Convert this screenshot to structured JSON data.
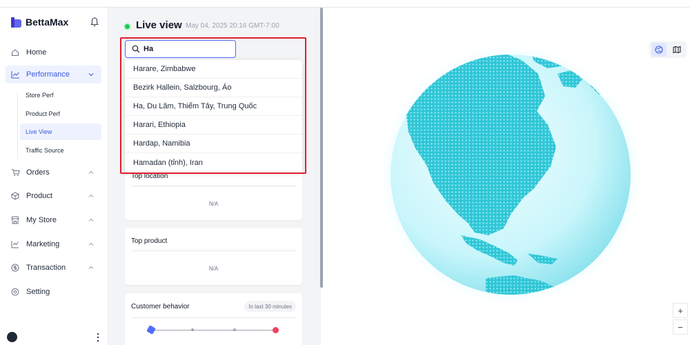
{
  "app": {
    "brand": "BettaMax"
  },
  "sidebar": {
    "items": [
      {
        "label": "Home",
        "icon": "home-icon"
      },
      {
        "label": "Performance",
        "icon": "chart-icon"
      },
      {
        "label": "Orders",
        "icon": "cart-icon"
      },
      {
        "label": "Product",
        "icon": "box-icon"
      },
      {
        "label": "My Store",
        "icon": "store-icon"
      },
      {
        "label": "Marketing",
        "icon": "megaphone-icon"
      },
      {
        "label": "Transaction",
        "icon": "money-icon"
      },
      {
        "label": "Setting",
        "icon": "gear-icon"
      }
    ],
    "performance_sub": [
      "Store Perf",
      "Product Perf",
      "Live View",
      "Traffic Source"
    ]
  },
  "live": {
    "title": "Live view",
    "datetime": "May 04, 2025 20:16 GMT-7:00"
  },
  "search": {
    "value": "Ha",
    "results": [
      "Harare, Zimbabwe",
      "Bezirk Hallein, Salzbourg, Áo",
      "Ha, Du Lâm, Thiểm Tây, Trung Quốc",
      "Harari, Ethiopia",
      "Hardap, Namibia",
      "Hamadan (tỉnh), Iran"
    ]
  },
  "cards": {
    "top_location": {
      "title": "Top location",
      "value": "N/A"
    },
    "top_product": {
      "title": "Top product",
      "value": "N/A"
    },
    "customer_behavior": {
      "title": "Customer behavior",
      "badge": "In last 30 minutes"
    }
  },
  "map": {
    "zoom_in": "+",
    "zoom_out": "−",
    "globe_color": "#2fc6d6",
    "accent": "#4f6ef7"
  }
}
